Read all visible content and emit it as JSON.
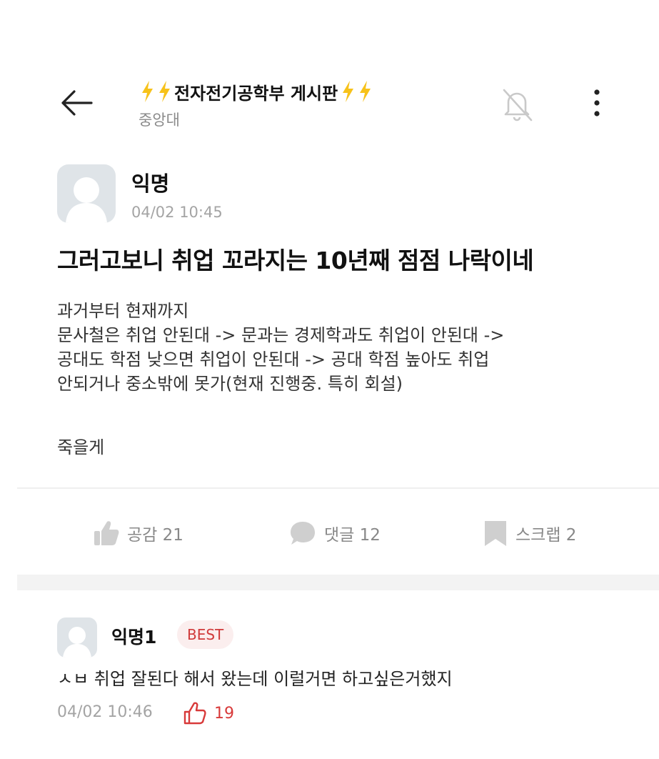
{
  "header": {
    "board_title": "전자전기공학부 게시판",
    "school": "중앙대",
    "icons": [
      "back-arrow-icon",
      "lightning-icon",
      "bell-off-icon",
      "more-vertical-icon"
    ],
    "bolt_color": "#f7c21a"
  },
  "post": {
    "author": "익명",
    "time": "04/02 10:45",
    "title": "그러고보니 취업 꼬라지는 10년째 점점 나락이네",
    "body_lines": [
      "과거부터 현재까지",
      "문사철은 취업 안된대 -> 문과는 경제학과도 취업이 안된대 ->",
      "공대도 학점 낮으면 취업이 안된대 -> 공대 학점 높아도 취업",
      "안되거나 중소밖에 못가(현재 진행중. 특히 회설)"
    ],
    "closing": "죽을게"
  },
  "actions": {
    "like": "공감 21",
    "comment": "댓글 12",
    "scrap": "스크랩 2"
  },
  "comment": {
    "author": "익명1",
    "badge": "BEST",
    "text": "ㅅㅂ 취업 잘된다 해서 왔는데 이럴거면 하고싶은거했지",
    "time": "04/02 10:46",
    "likes": "19",
    "accent_color": "#d83a3a"
  }
}
